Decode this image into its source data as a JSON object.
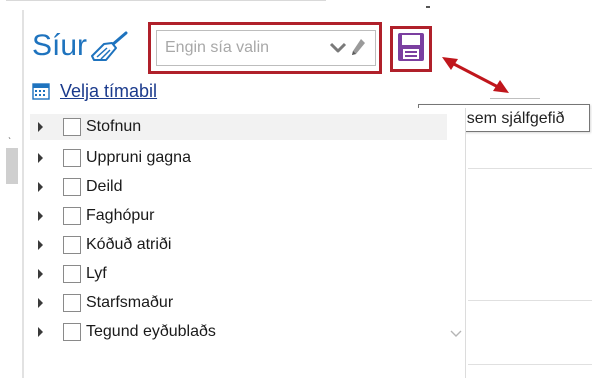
{
  "header": {
    "title": "Síur",
    "filter_placeholder": "Engin sía valin"
  },
  "period": {
    "link_label": "Velja tímabil"
  },
  "tooltip": {
    "text": "Vista sem sjálfgefið"
  },
  "tree": {
    "items": [
      {
        "label": "Stofnun",
        "checked": false,
        "selected": true
      },
      {
        "label": "Uppruni gagna",
        "checked": false,
        "selected": false
      },
      {
        "label": "Deild",
        "checked": false,
        "selected": false
      },
      {
        "label": "Faghópur",
        "checked": false,
        "selected": false
      },
      {
        "label": "Kóðuð atriði",
        "checked": false,
        "selected": false
      },
      {
        "label": "Lyf",
        "checked": false,
        "selected": false
      },
      {
        "label": "Starfsmaður",
        "checked": false,
        "selected": false
      },
      {
        "label": "Tegund eyðublaðs",
        "checked": false,
        "selected": false
      }
    ]
  },
  "colors": {
    "title_blue": "#1e73be",
    "highlight_red": "#b0202a",
    "save_purple": "#7b3fa0",
    "link_blue": "#1a3a8c"
  },
  "icons": {
    "clear": "broom-icon",
    "dropdown": "chevron-down-icon",
    "edit": "pencil-icon",
    "save": "floppy-disk-icon",
    "calendar": "calendar-icon"
  }
}
